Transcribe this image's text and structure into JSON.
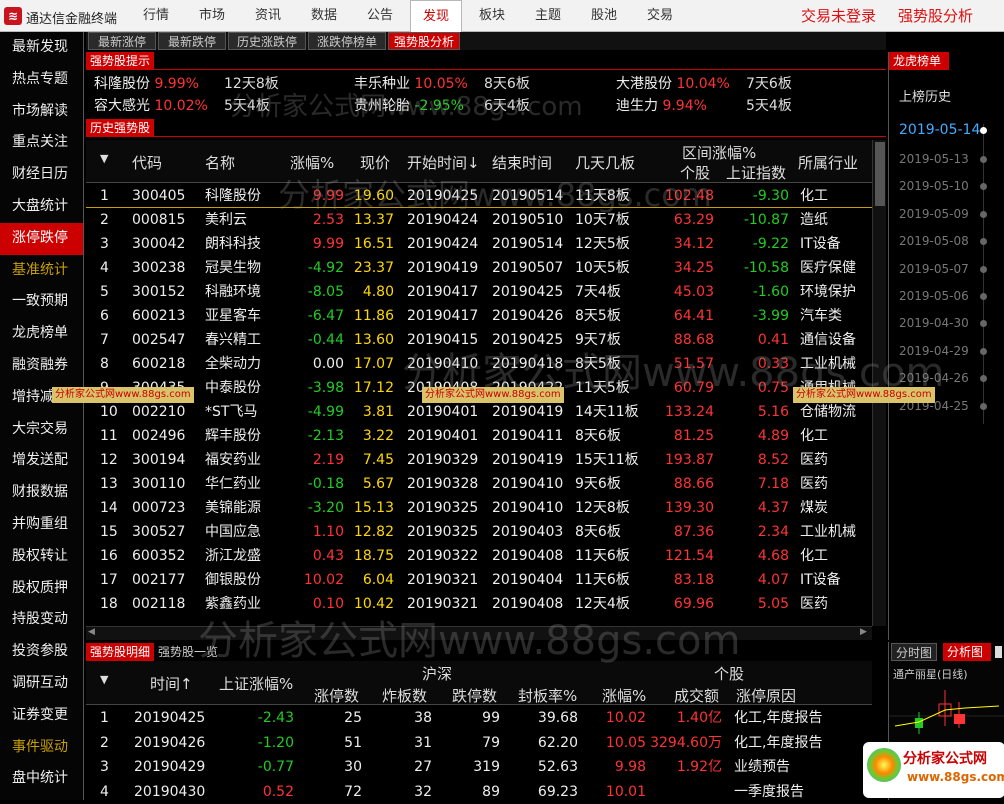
{
  "app": {
    "title": "通达信金融终端",
    "logo": "≋"
  },
  "menu": [
    "行情",
    "市场",
    "资讯",
    "数据",
    "公告",
    "发现",
    "板块",
    "主题",
    "股池",
    "交易"
  ],
  "menu_active": 5,
  "top_right": {
    "login": "交易未登录",
    "analysis": "强势股分析"
  },
  "sidebar": [
    "最新发现",
    "热点专题",
    "市场解读",
    "重点关注",
    "财经日历",
    "大盘统计",
    "涨停跌停",
    "基准统计",
    "一致预期",
    "龙虎榜单",
    "融资融券",
    "增持减持",
    "大宗交易",
    "增发送配",
    "财报数据",
    "并购重组",
    "股权转让",
    "股权质押",
    "持股变动",
    "投资参股",
    "调研互动",
    "证券变更",
    "事件驱动",
    "盘中统计"
  ],
  "sidebar_active": 6,
  "tabs": [
    "最新涨停",
    "最新跌停",
    "历史涨跌停",
    "涨跌停榜单",
    "强势股分析"
  ],
  "hot_title": "强势股提示",
  "hot": [
    {
      "name": "科隆股份",
      "pct": "9.99%",
      "days": "12天8板"
    },
    {
      "name": "丰乐种业",
      "pct": "10.05%",
      "days": "8天6板"
    },
    {
      "name": "大港股份",
      "pct": "10.04%",
      "days": "7天6板"
    },
    {
      "name": "容大感光",
      "pct": "10.02%",
      "days": "5天4板"
    },
    {
      "name": "贵州轮胎",
      "pct": "-2.95%",
      "days": "6天4板"
    },
    {
      "name": "迪生力",
      "pct": "9.94%",
      "days": "5天4板"
    }
  ],
  "hist_title": "历史强势股",
  "main_header": {
    "code": "代码",
    "name": "名称",
    "pct": "涨幅%",
    "price": "现价",
    "start": "开始时间↓",
    "end": "结束时间",
    "days": "几天几板",
    "range": "区间涨幅%",
    "stock": "个股",
    "index": "上证指数",
    "industry": "所属行业"
  },
  "rows": [
    [
      "1",
      "300405",
      "科隆股份",
      "9.99",
      "19.60",
      "20190425",
      "20190514",
      "11天8板",
      "102.48",
      "-9.30",
      "化工"
    ],
    [
      "2",
      "000815",
      "美利云",
      "2.53",
      "13.37",
      "20190424",
      "20190510",
      "10天7板",
      "63.29",
      "-10.87",
      "造纸"
    ],
    [
      "3",
      "300042",
      "朗科科技",
      "9.99",
      "16.51",
      "20190424",
      "20190514",
      "12天5板",
      "34.12",
      "-9.22",
      "IT设备"
    ],
    [
      "4",
      "300238",
      "冠昊生物",
      "-4.92",
      "23.37",
      "20190419",
      "20190507",
      "10天5板",
      "34.25",
      "-10.58",
      "医疗保健"
    ],
    [
      "5",
      "300152",
      "科融环境",
      "-8.05",
      "4.80",
      "20190417",
      "20190425",
      "7天4板",
      "45.03",
      "-1.60",
      "环境保护"
    ],
    [
      "6",
      "600213",
      "亚星客车",
      "-6.47",
      "11.86",
      "20190417",
      "20190426",
      "8天5板",
      "64.41",
      "-3.99",
      "汽车类"
    ],
    [
      "7",
      "002547",
      "春兴精工",
      "-0.44",
      "13.60",
      "20190415",
      "20190425",
      "9天7板",
      "88.68",
      "0.41",
      "通信设备"
    ],
    [
      "8",
      "600218",
      "全柴动力",
      "0.00",
      "17.07",
      "20190410",
      "20190418",
      "8天5板",
      "51.57",
      "0.33",
      "工业机械"
    ],
    [
      "9",
      "300435",
      "中泰股份",
      "-3.98",
      "17.12",
      "20190408",
      "20190422",
      "11天5板",
      "60.79",
      "0.75",
      "通用机械"
    ],
    [
      "10",
      "002210",
      "*ST飞马",
      "-4.99",
      "3.81",
      "20190401",
      "20190419",
      "14天11板",
      "133.24",
      "5.16",
      "仓储物流"
    ],
    [
      "11",
      "002496",
      "辉丰股份",
      "-2.13",
      "3.22",
      "20190401",
      "20190411",
      "8天6板",
      "81.25",
      "4.89",
      "化工"
    ],
    [
      "12",
      "300194",
      "福安药业",
      "2.19",
      "7.45",
      "20190329",
      "20190419",
      "15天11板",
      "193.87",
      "8.52",
      "医药"
    ],
    [
      "13",
      "300110",
      "华仁药业",
      "-0.18",
      "5.67",
      "20190328",
      "20190410",
      "9天6板",
      "88.66",
      "7.18",
      "医药"
    ],
    [
      "14",
      "000723",
      "美锦能源",
      "-3.20",
      "15.13",
      "20190325",
      "20190410",
      "12天8板",
      "139.30",
      "4.37",
      "煤炭"
    ],
    [
      "15",
      "300527",
      "中国应急",
      "1.10",
      "12.82",
      "20190325",
      "20190403",
      "8天6板",
      "87.36",
      "2.34",
      "工业机械"
    ],
    [
      "16",
      "600352",
      "浙江龙盛",
      "0.43",
      "18.75",
      "20190322",
      "20190408",
      "11天6板",
      "121.54",
      "4.68",
      "化工"
    ],
    [
      "17",
      "002177",
      "御银股份",
      "10.02",
      "6.04",
      "20190321",
      "20190404",
      "11天6板",
      "83.18",
      "4.07",
      "IT设备"
    ],
    [
      "18",
      "002118",
      "紫鑫药业",
      "0.10",
      "10.42",
      "20190321",
      "20190408",
      "12天4板",
      "69.96",
      "5.05",
      "医药"
    ]
  ],
  "right_panel": {
    "title": "龙虎榜单",
    "subtitle": "上榜历史",
    "dates": [
      "2019-05-14",
      "2019-05-13",
      "2019-05-10",
      "2019-05-09",
      "2019-05-08",
      "2019-05-07",
      "2019-05-06",
      "2019-04-30",
      "2019-04-29",
      "2019-04-26",
      "2019-04-25"
    ]
  },
  "bottom_tabs": [
    "强势股明细",
    "强势股一览"
  ],
  "bottom_header": {
    "time": "时间↑",
    "index_pct": "上证涨幅%",
    "hushen": "沪深",
    "up_count": "涨停数",
    "break_count": "炸板数",
    "down_count": "跌停数",
    "seal_rate": "封板率%",
    "stock": "个股",
    "pct": "涨幅%",
    "turnover": "成交额",
    "reason": "涨停原因"
  },
  "bottom_rows": [
    [
      "1",
      "20190425",
      "-2.43",
      "25",
      "38",
      "99",
      "39.68",
      "10.02",
      "1.40亿",
      "化工,年度报告"
    ],
    [
      "2",
      "20190426",
      "-1.20",
      "51",
      "31",
      "79",
      "62.20",
      "10.05",
      "3294.60万",
      "化工,年度报告"
    ],
    [
      "3",
      "20190429",
      "-0.77",
      "30",
      "27",
      "319",
      "52.63",
      "9.98",
      "1.92亿",
      "业绩预告"
    ],
    [
      "4",
      "20190430",
      "0.52",
      "72",
      "32",
      "89",
      "69.23",
      "10.01",
      "",
      "一季度报告"
    ]
  ],
  "right_bottom": {
    "tab1": "分时图",
    "tab2": "分析图",
    "stock": "通产丽星(日线)"
  },
  "watermark": {
    "big": "分析家公式网www.88gs.com",
    "strip": "分析家公式网www.88gs.com",
    "logo_name": "分析家公式网",
    "logo_url": "www.88gs.com"
  }
}
